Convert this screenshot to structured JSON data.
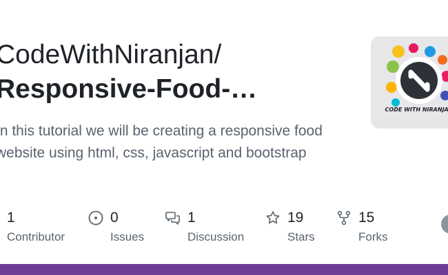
{
  "repo": {
    "owner": "CodeWithNiranjan/",
    "name": "Responsive-Food-…",
    "description": "In this tutorial we will be creating a responsive food website using html, css, javascript and bootstrap"
  },
  "thumbnail": {
    "caption": "CODE WITH NIRANJAN"
  },
  "stats": [
    {
      "icon": "people-icon",
      "count": "1",
      "label": "Contributor"
    },
    {
      "icon": "issue-icon",
      "count": "0",
      "label": "Issues"
    },
    {
      "icon": "discussion-icon",
      "count": "1",
      "label": "Discussion"
    },
    {
      "icon": "star-icon",
      "count": "19",
      "label": "Stars"
    },
    {
      "icon": "fork-icon",
      "count": "15",
      "label": "Forks"
    }
  ],
  "colors": {
    "accent_bar": "#6f3c98",
    "text": "#1f2328",
    "muted": "#59636e"
  }
}
